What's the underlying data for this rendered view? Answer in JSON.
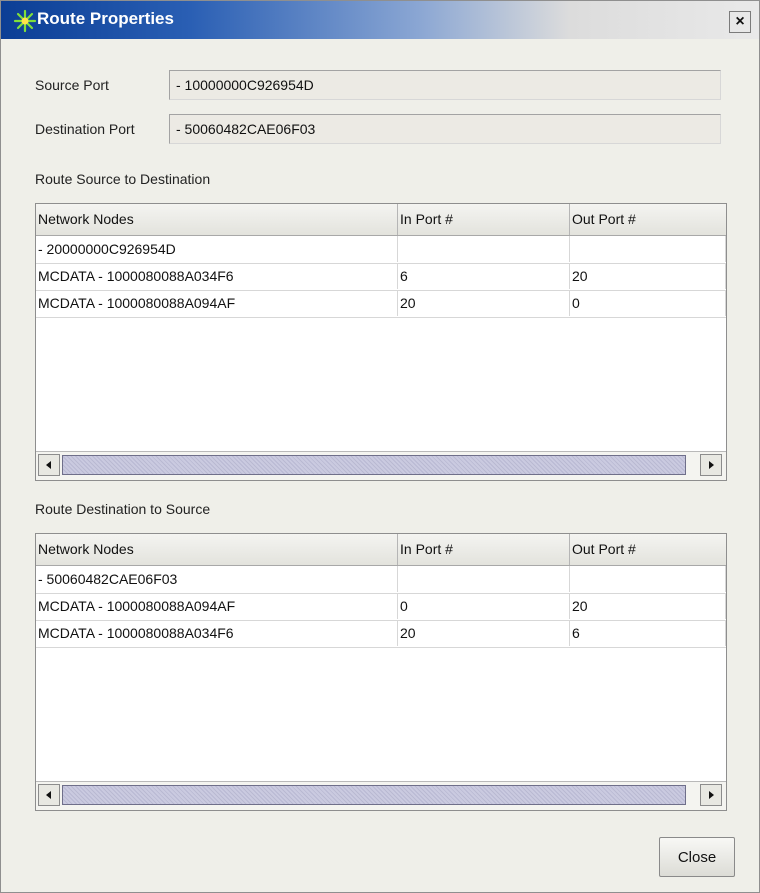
{
  "window": {
    "title": "Route Properties",
    "close_glyph": "×"
  },
  "fields": {
    "source_port_label": "Source Port",
    "source_port_value": "- 10000000C926954D",
    "destination_port_label": "Destination Port",
    "destination_port_value": "- 50060482CAE06F03"
  },
  "route_src_to_dst": {
    "label": "Route Source to Destination",
    "columns": [
      "Network Nodes",
      "In Port #",
      "Out Port #"
    ],
    "rows": [
      [
        "- 20000000C926954D",
        "",
        ""
      ],
      [
        "MCDATA - 1000080088A034F6",
        "6",
        "20"
      ],
      [
        "MCDATA - 1000080088A094AF",
        "20",
        "0"
      ]
    ]
  },
  "route_dst_to_src": {
    "label": "Route Destination to Source",
    "columns": [
      "Network Nodes",
      "In Port #",
      "Out Port #"
    ],
    "rows": [
      [
        "- 50060482CAE06F03",
        "",
        ""
      ],
      [
        "MCDATA - 1000080088A094AF",
        "0",
        "20"
      ],
      [
        "MCDATA - 1000080088A034F6",
        "20",
        "6"
      ]
    ]
  },
  "buttons": {
    "close_label": "Close"
  },
  "icons": {
    "title_icon": "route-star-icon",
    "scroll_left": "arrow-left-icon",
    "scroll_right": "arrow-right-icon"
  },
  "colors": {
    "title_bar_start": "#0b3e95",
    "dialog_background": "#efefe9",
    "scroll_thumb": "#c3c3da"
  }
}
